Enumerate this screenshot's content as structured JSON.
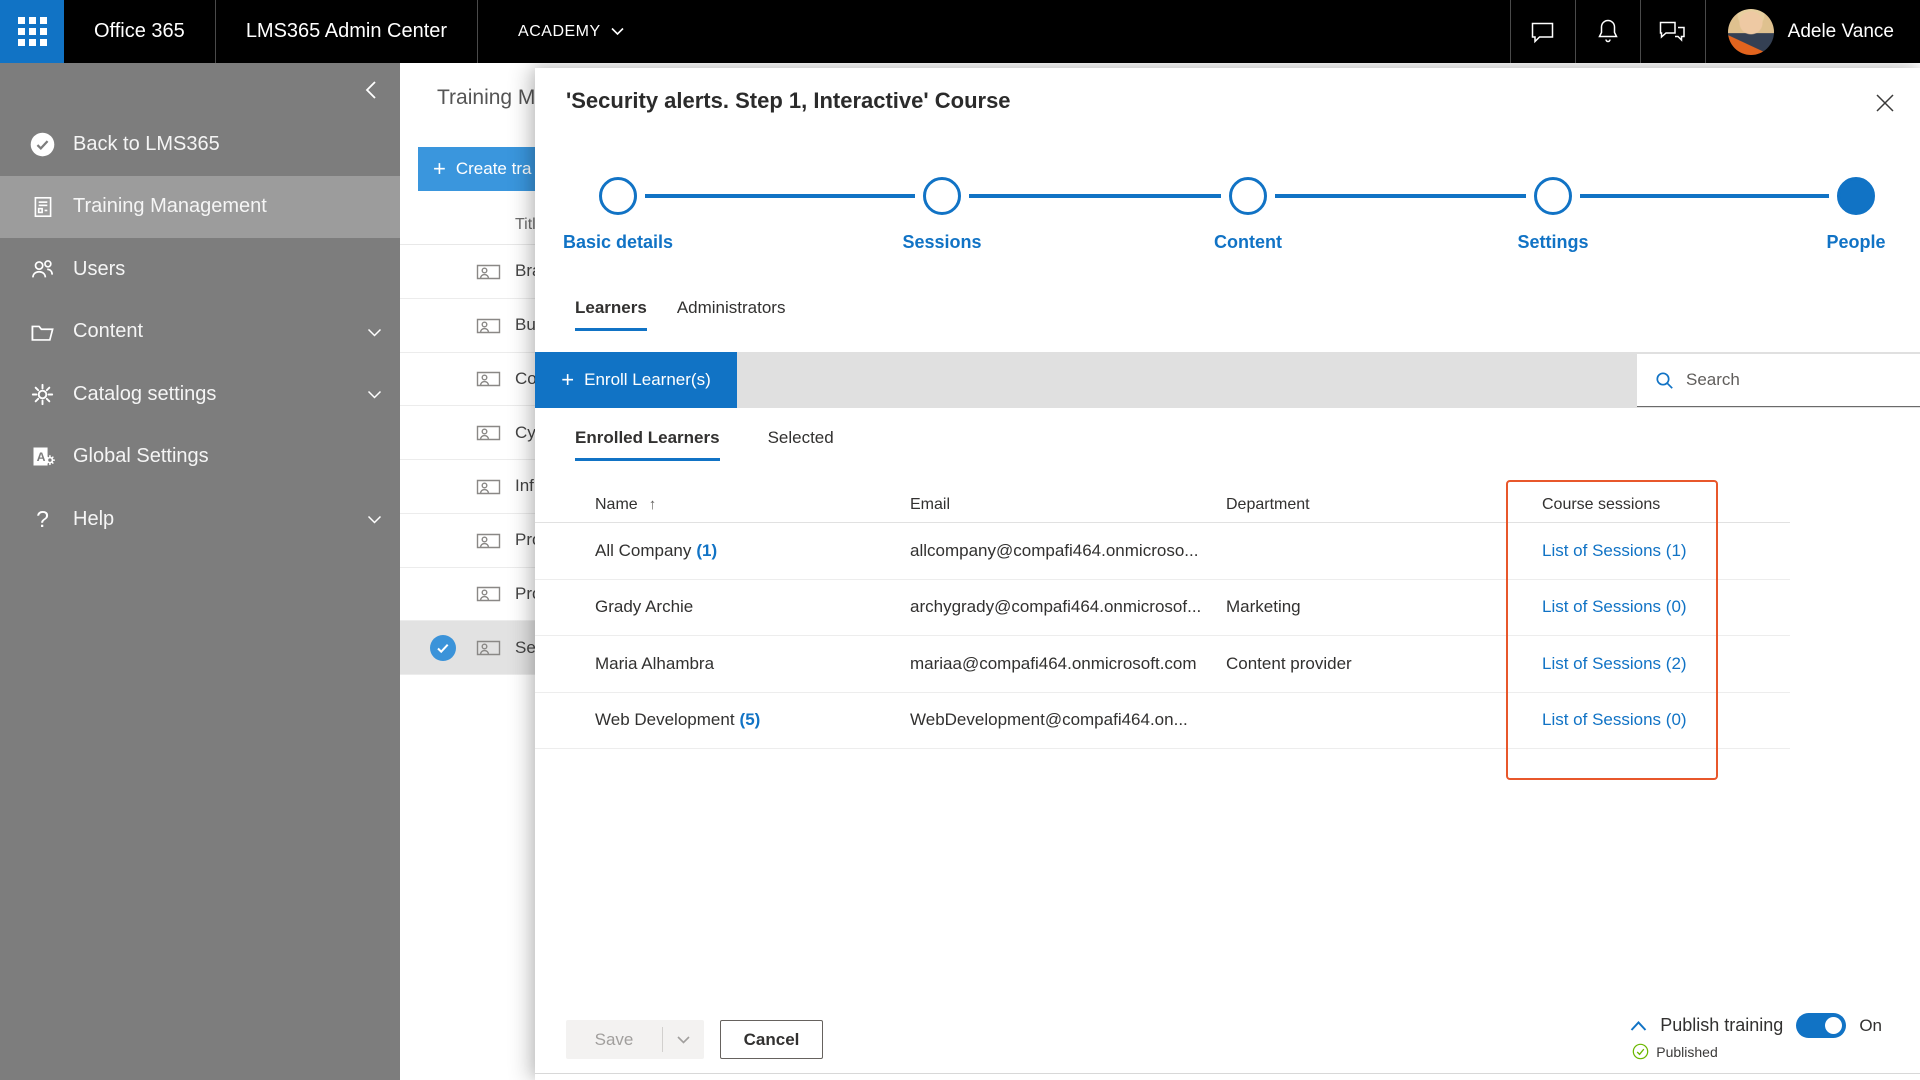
{
  "topbar": {
    "brand": "Office 365",
    "product": "LMS365 Admin Center",
    "tenant": "ACADEMY",
    "user_name": "Adele Vance",
    "icons": [
      "app-launcher-icon",
      "chat-icon",
      "bell-icon",
      "feedback-icon"
    ]
  },
  "sidebar": {
    "items": [
      {
        "label": "Back to LMS365",
        "icon": "check-circle-icon",
        "expandable": false,
        "active": false
      },
      {
        "label": "Training Management",
        "icon": "report-icon",
        "expandable": false,
        "active": true
      },
      {
        "label": "Users",
        "icon": "people-icon",
        "expandable": false,
        "active": false
      },
      {
        "label": "Content",
        "icon": "folder-icon",
        "expandable": true,
        "active": false
      },
      {
        "label": "Catalog settings",
        "icon": "gear-icon",
        "expandable": true,
        "active": false
      },
      {
        "label": "Global Settings",
        "icon": "app-settings-icon",
        "expandable": false,
        "active": false
      },
      {
        "label": "Help",
        "icon": "help-icon",
        "expandable": true,
        "active": false
      }
    ]
  },
  "background_page": {
    "title": "Training M",
    "create_button_label": "Create tra",
    "list_header": "Titl",
    "list_rows": [
      "Bra",
      "Bu",
      "Co",
      "Cy",
      "Inf",
      "Pro",
      "Pro",
      "Se"
    ],
    "selected_row_index": 7
  },
  "modal": {
    "title": "'Security alerts. Step 1, Interactive' Course",
    "stepper": [
      {
        "label": "Basic details",
        "state": "upcoming"
      },
      {
        "label": "Sessions",
        "state": "upcoming"
      },
      {
        "label": "Content",
        "state": "upcoming"
      },
      {
        "label": "Settings",
        "state": "upcoming"
      },
      {
        "label": "People",
        "state": "current"
      }
    ],
    "tabs": [
      {
        "label": "Learners",
        "active": true
      },
      {
        "label": "Administrators",
        "active": false
      }
    ],
    "enroll_button_label": "Enroll Learner(s)",
    "search_placeholder": "Search",
    "subtabs": [
      {
        "label": "Enrolled Learners",
        "active": true
      },
      {
        "label": "Selected",
        "active": false
      }
    ],
    "table": {
      "columns": [
        "Name",
        "Email",
        "Department",
        "Course sessions"
      ],
      "rows": [
        {
          "name": "All Company",
          "count": "(1)",
          "email": "allcompany@compafi464.onmicroso...",
          "department": "",
          "sessions_link": "List of Sessions (1)"
        },
        {
          "name": "Grady Archie",
          "count": "",
          "email": "archygrady@compafi464.onmicrosof...",
          "department": "Marketing",
          "sessions_link": "List of Sessions (0)"
        },
        {
          "name": "Maria Alhambra",
          "count": "",
          "email": "mariaa@compafi464.onmicrosoft.com",
          "department": "Content provider",
          "sessions_link": "List of Sessions (2)"
        },
        {
          "name": "Web Development",
          "count": "(5)",
          "email": "WebDevelopment@compafi464.on...",
          "department": "",
          "sessions_link": "List of Sessions (0)"
        }
      ]
    },
    "footer": {
      "save_label": "Save",
      "cancel_label": "Cancel",
      "publish_label": "Publish training",
      "publish_state": "On",
      "publish_status": "Published"
    }
  },
  "colors": {
    "accent_blue": "#1173c5",
    "topbar_bg": "#000000",
    "sidebar_bg": "#7d7d7d",
    "sidebar_active": "#9c9c9c",
    "toolbar_gray": "#e0e0e0",
    "highlight_orange": "#e8572b",
    "published_green": "#6bb700"
  }
}
